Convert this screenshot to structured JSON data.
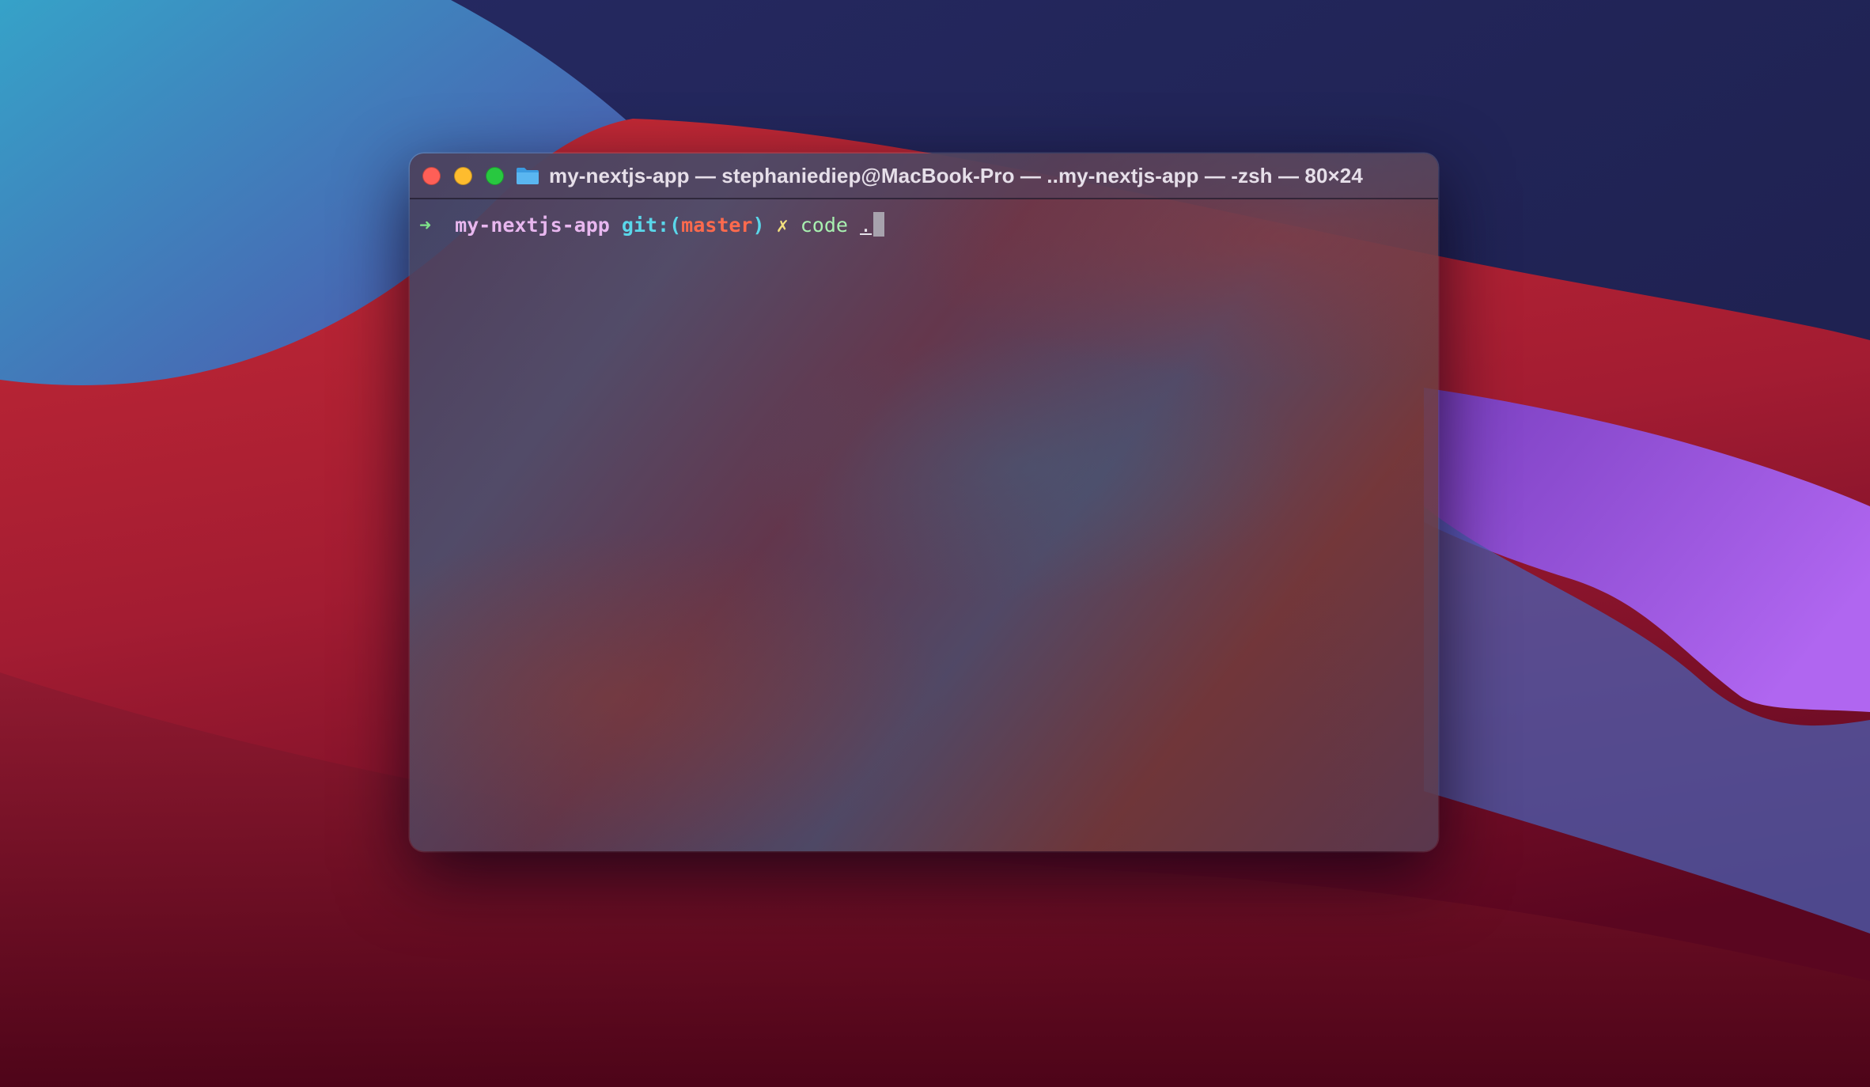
{
  "window": {
    "title": "my-nextjs-app — stephaniediep@MacBook-Pro — ..my-nextjs-app — -zsh — 80×24",
    "icon": "folder-icon"
  },
  "prompt": {
    "arrow": "➜",
    "directory": "my-nextjs-app",
    "git_prefix": "git:(",
    "branch": "master",
    "git_suffix": ")",
    "dirty_marker": "✗",
    "command": "code",
    "argument": "."
  },
  "colors": {
    "arrow": "#7fe38a",
    "directory": "#e8b7ef",
    "git": "#5ad7ea",
    "branch": "#ff6a4d",
    "dirty": "#f3e07e",
    "command": "#a8f0b0",
    "close": "#ff5f57",
    "minimize": "#febc2e",
    "zoom": "#28c840"
  }
}
